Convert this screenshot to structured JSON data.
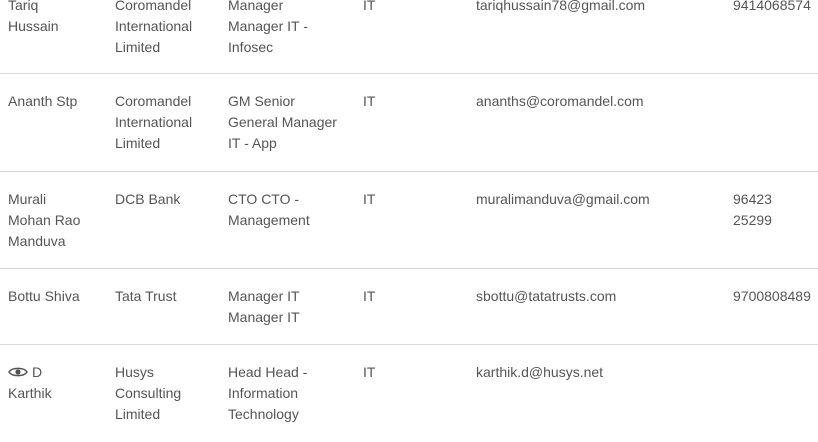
{
  "rows": [
    {
      "name": [
        "Tariq",
        "Hussain"
      ],
      "company": [
        "Coromandel",
        "International",
        "Limited"
      ],
      "title": [
        "Manager",
        "Manager IT -",
        "Infosec"
      ],
      "dept": "IT",
      "email": "tariqhussain78@gmail.com",
      "phone": [
        "9414068574"
      ]
    },
    {
      "name": [
        "Ananth Stp"
      ],
      "company": [
        "Coromandel",
        "International",
        "Limited"
      ],
      "title": [
        "GM Senior",
        "General Manager",
        "IT - App"
      ],
      "dept": "IT",
      "email": "ananths@coromandel.com",
      "phone": []
    },
    {
      "name": [
        "Murali",
        "Mohan Rao",
        "Manduva"
      ],
      "company": [
        "DCB Bank"
      ],
      "title": [
        "CTO CTO -",
        "Management"
      ],
      "dept": "IT",
      "email": "muralimanduva@gmail.com",
      "phone": [
        "96423",
        "25299"
      ]
    },
    {
      "name": [
        "Bottu Shiva"
      ],
      "company": [
        "Tata Trust"
      ],
      "title": [
        "Manager IT",
        "Manager IT"
      ],
      "dept": "IT",
      "email": "sbottu@tatatrusts.com",
      "phone": [
        "9700808489"
      ]
    },
    {
      "name": [
        "D",
        "Karthik"
      ],
      "name_icon": "eye-icon",
      "company": [
        "Husys",
        "Consulting",
        "Limited"
      ],
      "title": [
        "Head Head -",
        "Information",
        "Technology"
      ],
      "dept": "IT",
      "email": "karthik.d@husys.net",
      "phone": []
    }
  ],
  "colors": {
    "text": "#555555",
    "divider": "#d8d8d8",
    "background": "#ffffff"
  }
}
